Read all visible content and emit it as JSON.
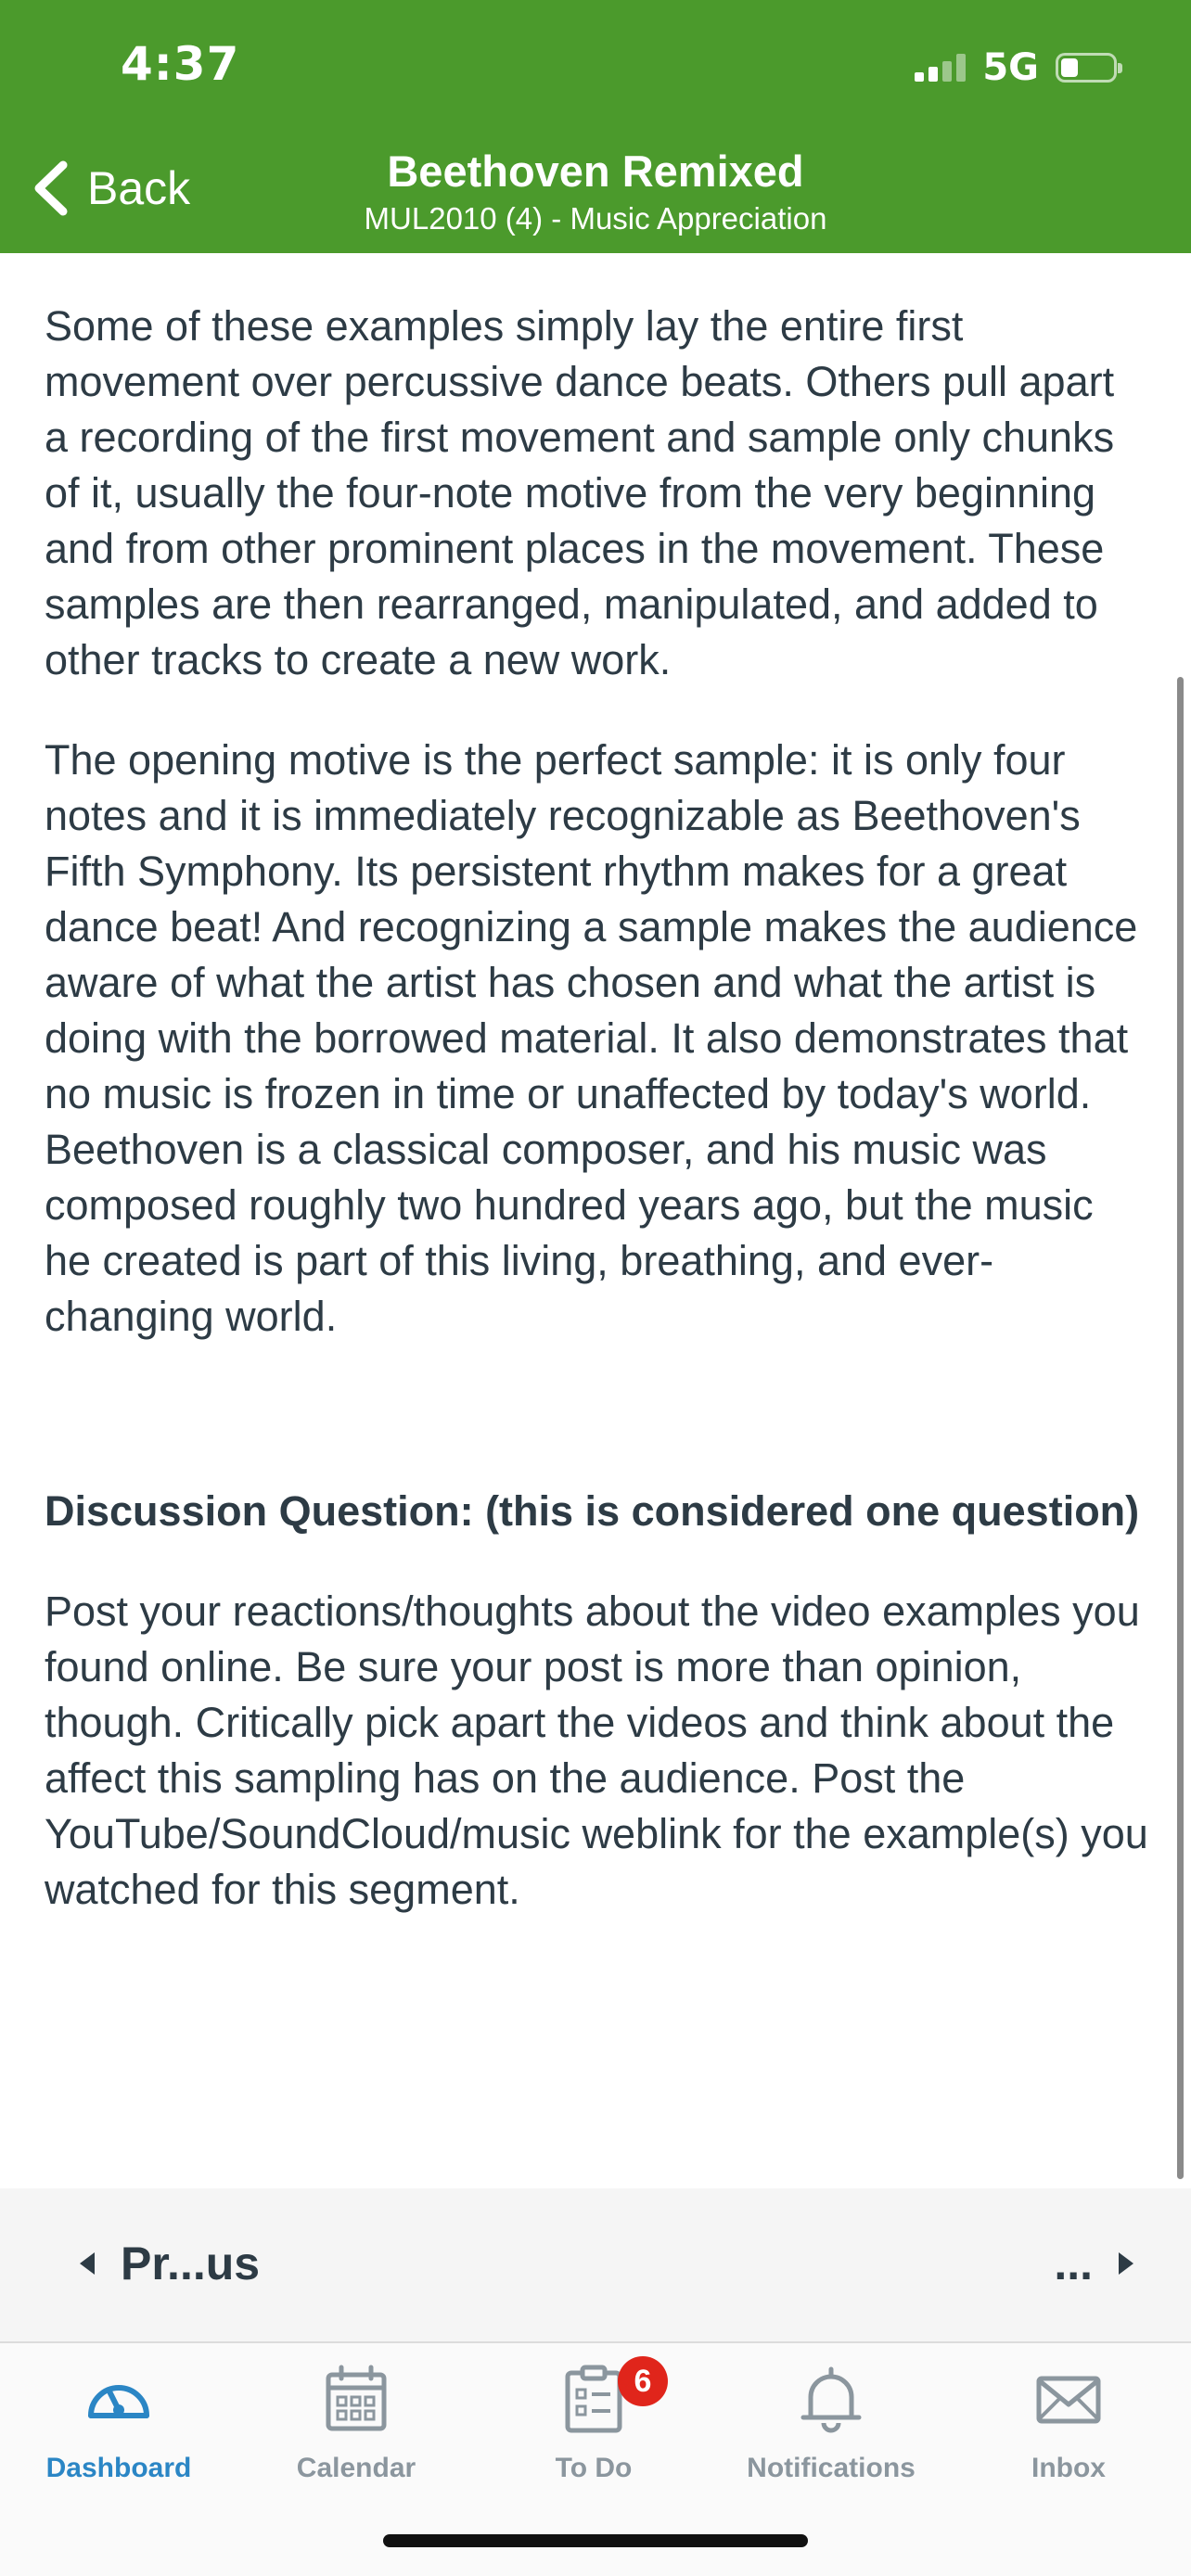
{
  "status_bar": {
    "time": "4:37",
    "network": "5G"
  },
  "header": {
    "back_label": "Back",
    "title": "Beethoven Remixed",
    "subtitle": "MUL2010 (4) - Music Appreciation"
  },
  "content": {
    "paragraph_1": "Some of these examples simply lay the entire first movement over percussive dance beats. Others pull apart a recording of the first movement and sample only chunks of it, usually the four-note motive from the very beginning and from other prominent places in the movement. These samples are then rearranged, manipulated, and added to other tracks to create a new work.",
    "paragraph_2": "The opening motive is the perfect sample: it is only four notes and it is immediately recognizable as Beethoven's Fifth Symphony. Its persistent rhythm makes for a great dance beat! And recognizing a sample makes the audience aware of what the artist has chosen and what the artist is doing with the borrowed material. It also demonstrates that no music is frozen in time or unaffected by today's world. Beethoven is a classical composer, and his music was composed roughly two hundred years ago, but the music he created is part of this living, breathing, and ever-changing world.",
    "discussion_heading": "Discussion Question: (this is considered one question)",
    "paragraph_3": "Post your reactions/thoughts about the video examples you found online. Be sure your post is more than opinion, though. Critically pick apart the videos and think about the affect this sampling has on the audience. Post the YouTube/SoundCloud/music weblink for the example(s) you watched for this segment."
  },
  "pager": {
    "previous_label": "Pr...us",
    "next_label": "..."
  },
  "tabs": [
    {
      "label": "Dashboard",
      "icon": "dashboard-icon",
      "active": true
    },
    {
      "label": "Calendar",
      "icon": "calendar-icon",
      "active": false
    },
    {
      "label": "To Do",
      "icon": "todo-icon",
      "active": false,
      "badge": "6"
    },
    {
      "label": "Notifications",
      "icon": "bell-icon",
      "active": false
    },
    {
      "label": "Inbox",
      "icon": "mail-icon",
      "active": false
    }
  ],
  "colors": {
    "header_bg": "#4b9a2c",
    "active_tab": "#2b86c5",
    "inactive_tab": "#8b969e",
    "badge": "#e0251b",
    "text": "#2d3b45"
  }
}
